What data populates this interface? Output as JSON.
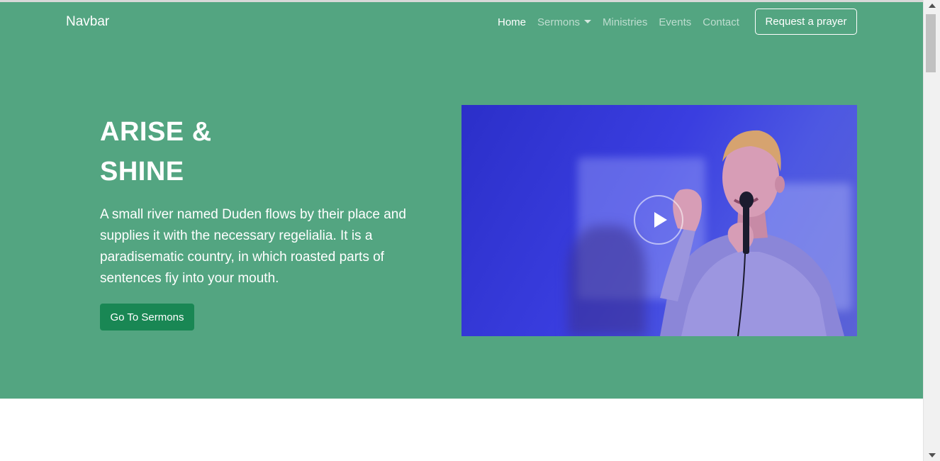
{
  "navbar": {
    "brand": "Navbar",
    "links": [
      {
        "label": "Home",
        "active": true
      },
      {
        "label": "Sermons",
        "dropdown": true
      },
      {
        "label": "Ministries"
      },
      {
        "label": "Events"
      },
      {
        "label": "Contact"
      }
    ],
    "prayer_button": "Request a prayer"
  },
  "hero": {
    "title_line1": "ARISE &",
    "title_line2": "SHINE",
    "text": "A small river named Duden flows by their place and supplies it with the necessary regelialia. It is a paradisematic country, in which roasted parts of sentences fiy into your mouth.",
    "cta_label": "Go To Sermons",
    "media_icon": "play-icon"
  },
  "colors": {
    "hero_bg": "#53a581",
    "cta_bg": "#198754",
    "media_blue": "#3a3ee0"
  }
}
